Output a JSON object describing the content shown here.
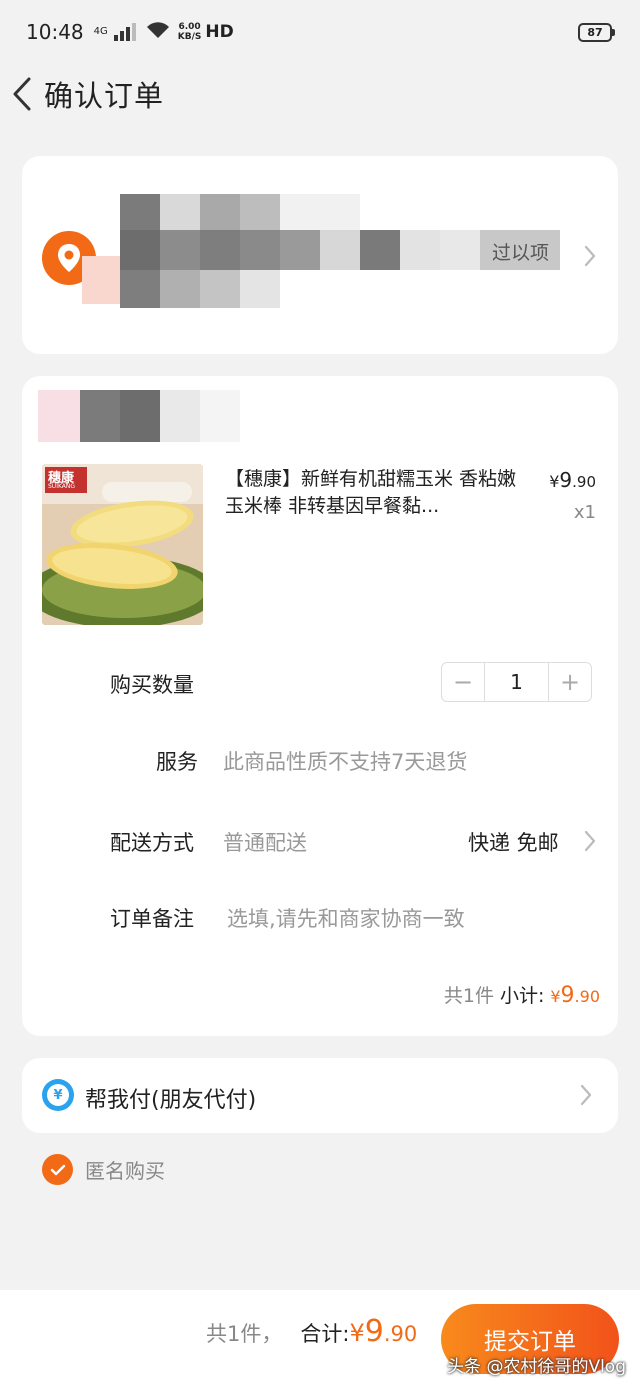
{
  "status_bar": {
    "time": "10:48",
    "network": "4G",
    "speed_value": "6.00",
    "speed_unit": "KB/S",
    "hd": "HD",
    "battery": "87"
  },
  "header": {
    "title": "确认订单"
  },
  "address": {
    "partial_text": "过以项"
  },
  "product": {
    "title": "【穗康】新鲜有机甜糯玉米 香粘嫩玉米棒 非转基因早餐黏...",
    "price_symbol": "¥",
    "price_int": "9",
    "price_dec": ".90",
    "quantity": "x1",
    "image_label": "穗康",
    "image_sublabel": "SUIKANG"
  },
  "form": {
    "quantity_label": "购买数量",
    "quantity_value": "1",
    "minus": "−",
    "plus": "+",
    "service_label": "服务",
    "service_value": "此商品性质不支持7天退货",
    "delivery_label": "配送方式",
    "delivery_value": "普通配送",
    "delivery_option": "快递 免邮",
    "remark_label": "订单备注",
    "remark_placeholder": "选填,请先和商家协商一致"
  },
  "subtotal": {
    "count": "共1件",
    "label": "小计:",
    "symbol": "¥",
    "int": "9",
    "dec": ".90"
  },
  "friend_pay": {
    "label": "帮我付(朋友代付)",
    "icon_glyph": "¥"
  },
  "anonymous": {
    "label": "匿名购买"
  },
  "bottom": {
    "count": "共1件，",
    "label": "合计:",
    "symbol": "¥",
    "int": "9",
    "dec": ".90",
    "submit": "提交订单"
  },
  "watermark": "头条 @农村徐哥的Vlog",
  "colors": {
    "accent": "#f36a16",
    "pay_blue": "#2ba3ec",
    "background": "#f2f2f2"
  }
}
